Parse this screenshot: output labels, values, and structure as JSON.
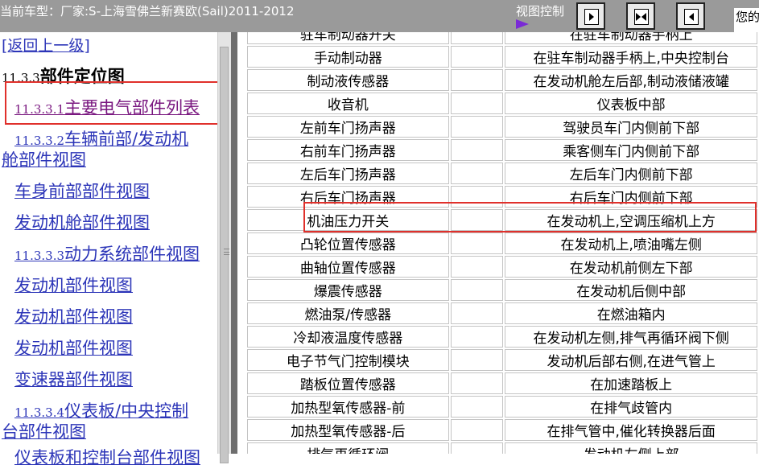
{
  "header": {
    "vehicle_label": "当前车型：厂家:S-上海雪佛兰新赛欧(Sail)2011-2012",
    "view_control_label": "视图控制",
    "welcome_text": "您的"
  },
  "nav": {
    "back_label": "[返回上一级]",
    "section_num": "11.3.3",
    "section_title": "部件定位图",
    "items": [
      {
        "num": "11.3.3.1",
        "label": "主要电气部件列表"
      },
      {
        "num": "11.3.3.2",
        "label": "车辆前部/发动机"
      },
      {
        "num": "",
        "label": "舱部件视图"
      },
      {
        "num": "",
        "label": "车身前部部件视图"
      },
      {
        "num": "",
        "label": "发动机舱部件视图"
      },
      {
        "num": "11.3.3.3",
        "label": "动力系统部件视图"
      },
      {
        "num": "",
        "label": "发动机部件视图"
      },
      {
        "num": "",
        "label": "发动机部件视图"
      },
      {
        "num": "",
        "label": "发动机部件视图"
      },
      {
        "num": "",
        "label": "变速器部件视图"
      },
      {
        "num": "11.3.3.4",
        "label": "仪表板/中央控制"
      },
      {
        "num": "",
        "label": "台部件视图"
      },
      {
        "num": "",
        "label": "仪表板和控制台部件视图"
      }
    ]
  },
  "table": {
    "rows": [
      {
        "name": "驻车制动器开关",
        "location": "在驻车制动器手柄上"
      },
      {
        "name": "手动制动器",
        "location": "在驻车制动器手柄上,中央控制台"
      },
      {
        "name": "制动液传感器",
        "location": "在发动机舱左后部,制动液储液罐"
      },
      {
        "name": "收音机",
        "location": "仪表板中部"
      },
      {
        "name": "左前车门扬声器",
        "location": "驾驶员车门内侧前下部"
      },
      {
        "name": "右前车门扬声器",
        "location": "乘客侧车门内侧前下部"
      },
      {
        "name": "左后车门扬声器",
        "location": "左后车门内侧前下部"
      },
      {
        "name": "右后车门扬声器",
        "location": "右后车门内侧前下部"
      },
      {
        "name": "机油压力开关",
        "location": "在发动机上,空调压缩机上方"
      },
      {
        "name": "凸轮位置传感器",
        "location": "在发动机上,喷油嘴左侧"
      },
      {
        "name": "曲轴位置传感器",
        "location": "在发动机前侧左下部"
      },
      {
        "name": "爆震传感器",
        "location": "在发动机后侧中部"
      },
      {
        "name": "燃油泵/传感器",
        "location": "在燃油箱内"
      },
      {
        "name": "冷却液温度传感器",
        "location": "在发动机左侧,排气再循环阀下侧"
      },
      {
        "name": "电子节气门控制模块",
        "location": "发动机后部右侧,在进气管上"
      },
      {
        "name": "踏板位置传感器",
        "location": "在加速踏板上"
      },
      {
        "name": "加热型氧传感器-前",
        "location": "在排气歧管内"
      },
      {
        "name": "加热型氧传感器-后",
        "location": "在排气管中,催化转换器后面"
      },
      {
        "name": "排气再循环阀",
        "location": "发动机左侧上部"
      }
    ]
  },
  "colors": {
    "link": "#2c35b8",
    "visited_link": "#7a1880",
    "highlight_box": "#e0302b",
    "topbar": "#9a9a9a"
  }
}
